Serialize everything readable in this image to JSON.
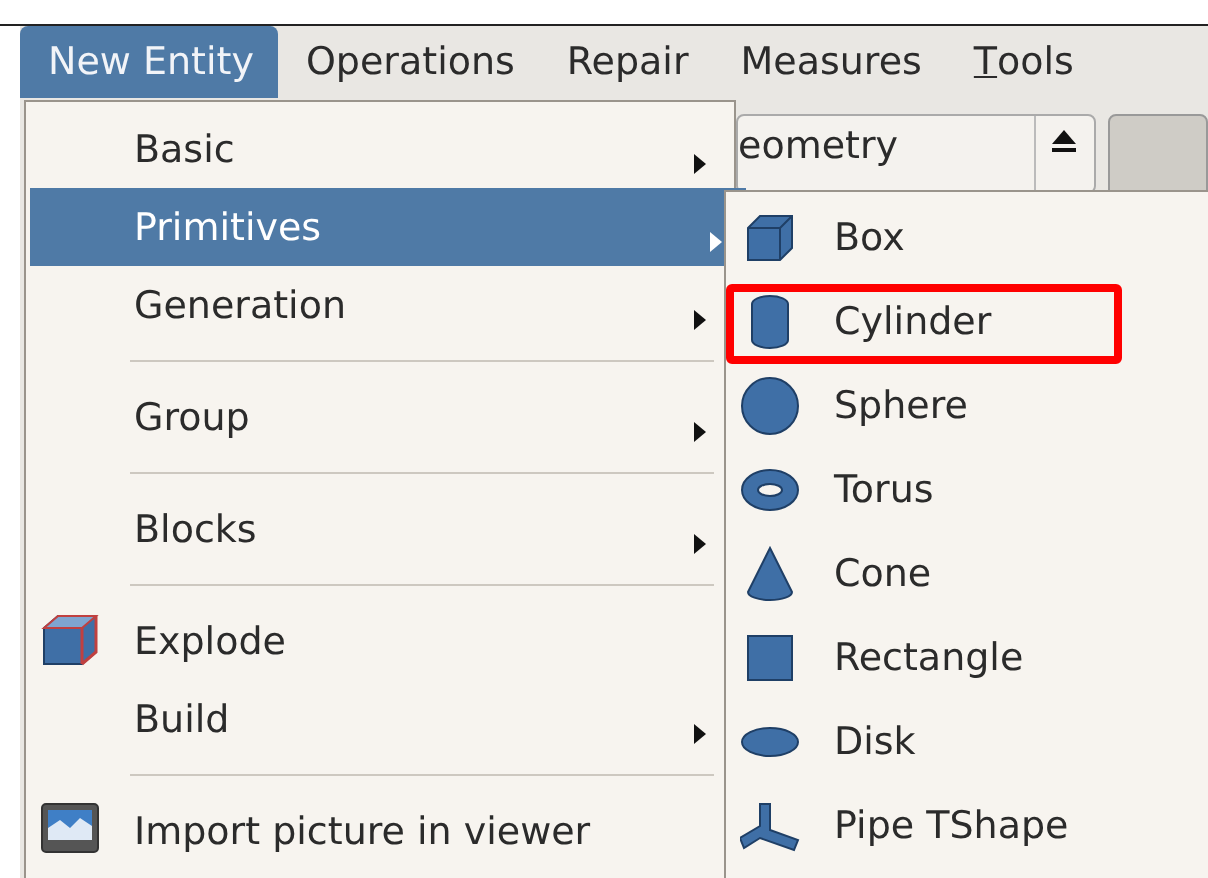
{
  "menubar": [
    {
      "label": "New Entity",
      "selected": true
    },
    {
      "label": "Operations",
      "selected": false
    },
    {
      "label": "Repair",
      "selected": false
    },
    {
      "label": "Measures",
      "selected": false
    },
    {
      "label": "Tools",
      "selected": false,
      "mnemonic_underlined": true
    }
  ],
  "toolbar": {
    "combo_text": "eometry"
  },
  "menu": [
    {
      "kind": "item",
      "label": "Basic",
      "submenu": true,
      "selected": false
    },
    {
      "kind": "item",
      "label": "Primitives",
      "submenu": true,
      "selected": true
    },
    {
      "kind": "item",
      "label": "Generation",
      "submenu": true,
      "selected": false
    },
    {
      "kind": "separator"
    },
    {
      "kind": "item",
      "label": "Group",
      "submenu": true,
      "selected": false
    },
    {
      "kind": "separator"
    },
    {
      "kind": "item",
      "label": "Blocks",
      "submenu": true,
      "selected": false
    },
    {
      "kind": "separator"
    },
    {
      "kind": "item",
      "label": "Explode",
      "submenu": false,
      "selected": false
    },
    {
      "kind": "item",
      "label": "Build",
      "submenu": true,
      "selected": false
    },
    {
      "kind": "separator"
    },
    {
      "kind": "item",
      "label": "Import picture in viewer",
      "submenu": false,
      "selected": false
    }
  ],
  "submenu": [
    {
      "label": "Box",
      "highlighted": false
    },
    {
      "label": "Cylinder",
      "highlighted": true
    },
    {
      "label": "Sphere",
      "highlighted": false
    },
    {
      "label": "Torus",
      "highlighted": false
    },
    {
      "label": "Cone",
      "highlighted": false
    },
    {
      "label": "Rectangle",
      "highlighted": false
    },
    {
      "label": "Disk",
      "highlighted": false
    },
    {
      "label": "Pipe TShape",
      "highlighted": false
    }
  ]
}
